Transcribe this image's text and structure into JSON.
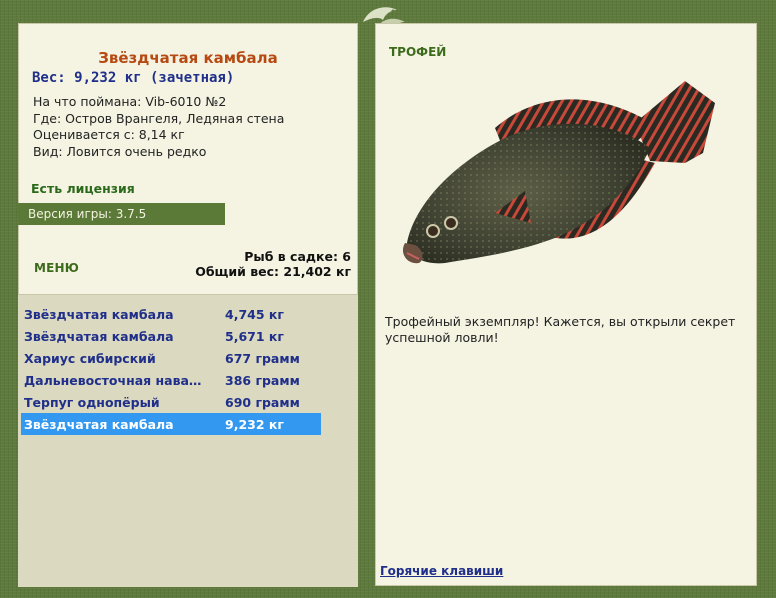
{
  "fish": {
    "name": "Звёздчатая камбала",
    "weight_line": "Вес: 9,232 кг (зачетная)",
    "details": [
      "На что поймана: Vib-6010 №2",
      "Где: Остров Врангеля, Ледяная стена",
      "Оценивается с: 8,14 кг",
      "Вид: Ловится очень редко"
    ]
  },
  "license_label": "Есть лицензия",
  "version_label": "Версия игры: 3.7.5",
  "menu_label": "МЕНЮ",
  "keepnet": {
    "count_line": "Рыб в садке: 6",
    "total_line": "Общий вес: 21,402 кг"
  },
  "catches": [
    {
      "name": "Звёздчатая камбала",
      "weight": "4,745 кг",
      "selected": false
    },
    {
      "name": "Звёздчатая камбала",
      "weight": "5,671 кг",
      "selected": false
    },
    {
      "name": "Хариус сибирский",
      "weight": "677 грамм",
      "selected": false
    },
    {
      "name": "Дальневосточная нава…",
      "weight": "386 грамм",
      "selected": false
    },
    {
      "name": "Терпуг однопёрый",
      "weight": "690 грамм",
      "selected": false
    },
    {
      "name": "Звёздчатая камбала",
      "weight": "9,232 кг",
      "selected": true
    }
  ],
  "trophy_label": "ТРОФЕЙ",
  "trophy_text": "Трофейный экземпляр! Кажется, вы открыли секрет успешной ловли!",
  "hotkeys_link": "Горячие клавиши",
  "colors": {
    "frame": "#5e7a3c",
    "panel": "#f5f4e3",
    "catch_area": "#dbd9c0",
    "selection": "#3399f0",
    "title": "#b64a12",
    "link_blue": "#1f2f8a"
  },
  "icons": {
    "logo": "fish-logo-icon",
    "trophy_image": "starry-flounder-image"
  }
}
